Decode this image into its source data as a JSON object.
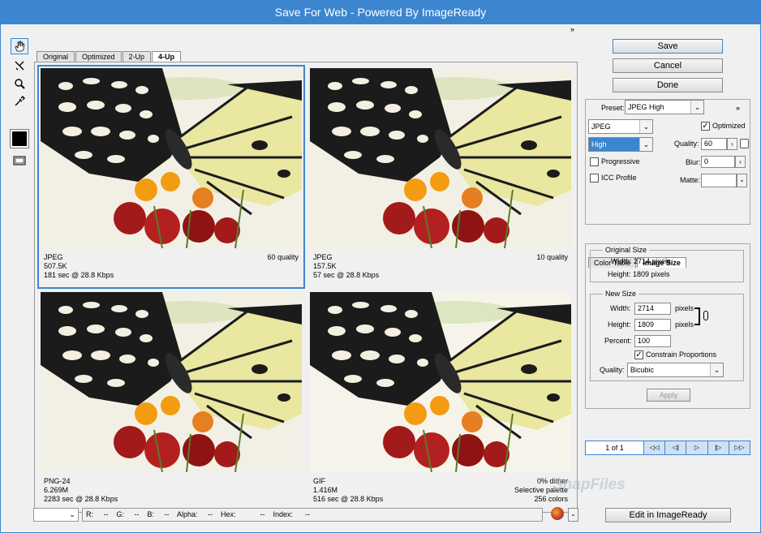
{
  "window": {
    "title": "Save For Web - Powered By ImageReady"
  },
  "tabs": [
    "Original",
    "Optimized",
    "2-Up",
    "4-Up"
  ],
  "tabs_more": "»",
  "panes": [
    {
      "format": "JPEG",
      "size": "507.5K",
      "time": "181 sec @ 28.8 Kbps",
      "right1": "60 quality",
      "right2": "",
      "right3": ""
    },
    {
      "format": "JPEG",
      "size": "157.5K",
      "time": "57 sec @ 28.8 Kbps",
      "right1": "10 quality",
      "right2": "",
      "right3": ""
    },
    {
      "format": "PNG-24",
      "size": "6.269M",
      "time": "2283 sec @ 28.8 Kbps",
      "right1": "",
      "right2": "",
      "right3": ""
    },
    {
      "format": "GIF",
      "size": "1.416M",
      "time": "516 sec @ 28.8 Kbps",
      "right1": "0% dither",
      "right2": "Selective palette",
      "right3": "256 colors"
    }
  ],
  "buttons": {
    "save": "Save",
    "cancel": "Cancel",
    "done": "Done",
    "apply": "Apply",
    "edit": "Edit in ImageReady"
  },
  "settings": {
    "preset_label": "Preset:",
    "preset": "JPEG High",
    "more": "»",
    "format": "JPEG",
    "quality_level": "High",
    "optimized_label": "Optimized",
    "quality_label": "Quality:",
    "quality": "60",
    "progressive_label": "Progressive",
    "blur_label": "Blur:",
    "blur": "0",
    "icc_label": "ICC Profile",
    "matte_label": "Matte:",
    "matte": ""
  },
  "subtabs": [
    "Color Table",
    "Image Size"
  ],
  "original_size": {
    "legend": "Original Size",
    "width": "Width: 2714 pixels",
    "height": "Height: 1809 pixels"
  },
  "new_size": {
    "legend": "New Size",
    "width_label": "Width:",
    "width": "2714",
    "width_unit": "pixels",
    "height_label": "Height:",
    "height": "1809",
    "height_unit": "pixels",
    "percent_label": "Percent:",
    "percent": "100",
    "constrain_label": "Constrain Proportions",
    "quality_label": "Quality:",
    "quality": "Bicubic"
  },
  "nav": {
    "page": "1 of 1",
    "first": "◁◁",
    "prev": "◁|",
    "play": "▷",
    "next": "|▷",
    "last": "▷▷"
  },
  "status": {
    "readout": "R:     --    G:     --    B:     --    Alpha:     --    Hex:            --    Index:      --",
    "zoom": ""
  },
  "watermark": "SnapFiles"
}
